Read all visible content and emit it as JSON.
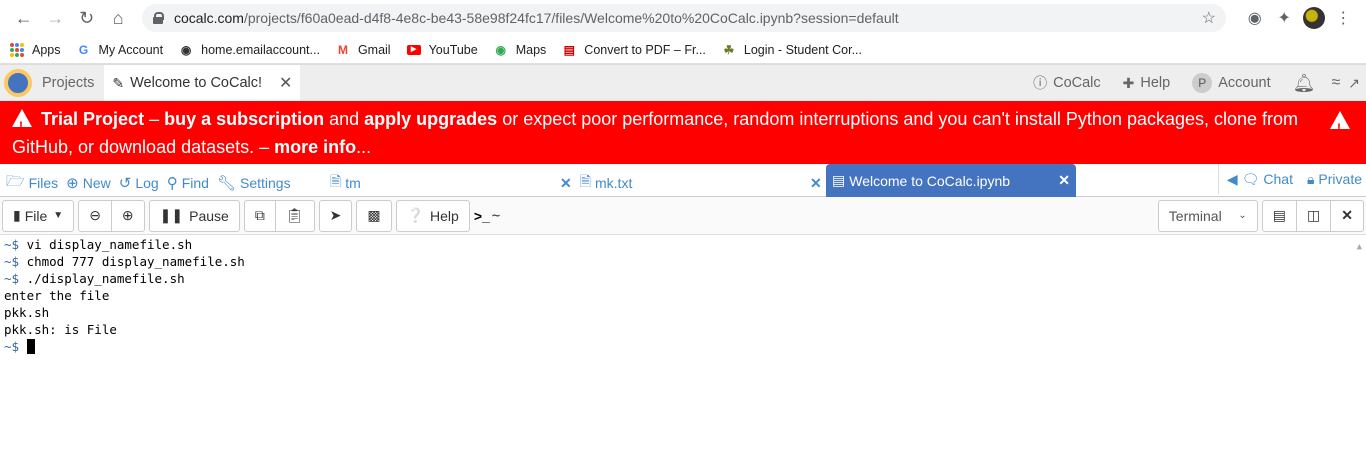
{
  "browser": {
    "url_host": "cocalc.com",
    "url_path": "/projects/f60a0ead-d4f8-4e8c-be43-58e98f24fc17/files/Welcome%20to%20CoCalc.ipynb?session=default",
    "bookmarks": [
      {
        "label": "Apps",
        "icon": "apps-grid-icon"
      },
      {
        "label": "My Account",
        "icon": "google-icon"
      },
      {
        "label": "home.emailaccount...",
        "icon": "globe-icon"
      },
      {
        "label": "Gmail",
        "icon": "gmail-icon"
      },
      {
        "label": "YouTube",
        "icon": "youtube-icon"
      },
      {
        "label": "Maps",
        "icon": "maps-icon"
      },
      {
        "label": "Convert to PDF – Fr...",
        "icon": "pdf-icon"
      },
      {
        "label": "Login - Student Cor...",
        "icon": "student-icon"
      }
    ]
  },
  "cocalc": {
    "projects_label": "Projects",
    "open_tab": "Welcome to CoCalc!",
    "right": {
      "cocalc": "CoCalc",
      "help": "Help",
      "account": "Account",
      "account_initial": "P"
    }
  },
  "banner": {
    "trial_project": "Trial Project",
    "dash1": " – ",
    "buy": "buy a subscription",
    "and": " and ",
    "apply": "apply upgrades",
    "rest": " or expect poor performance, random interruptions and you can't install Python packages, clone from GitHub, or download datasets. – ",
    "more": "more info",
    "ellipsis": "..."
  },
  "project_tabs": {
    "files": "Files",
    "new": "New",
    "log": "Log",
    "find": "Find",
    "settings": "Settings",
    "file_tabs": [
      "tm",
      "mk.txt",
      "Welcome to CoCalc.ipynb"
    ],
    "chat": "Chat",
    "private": "Private"
  },
  "toolbar": {
    "file": "File",
    "pause": "Pause",
    "help": "Help",
    "prompt": "~",
    "terminal_select": "Terminal"
  },
  "terminal": {
    "lines": [
      {
        "prompt": "~$ ",
        "text": "vi display_namefile.sh"
      },
      {
        "prompt": "~$ ",
        "text": "chmod 777 display_namefile.sh"
      },
      {
        "prompt": "~$ ",
        "text": "./display_namefile.sh"
      },
      {
        "prompt": "",
        "text": "enter the file"
      },
      {
        "prompt": "",
        "text": "pkk.sh"
      },
      {
        "prompt": "",
        "text": "pkk.sh: is File"
      },
      {
        "prompt": "~$ ",
        "text": ""
      }
    ]
  },
  "colors": {
    "banner_red": "#ff0000",
    "link_blue": "#428bca",
    "active_tab": "#4474c0"
  }
}
